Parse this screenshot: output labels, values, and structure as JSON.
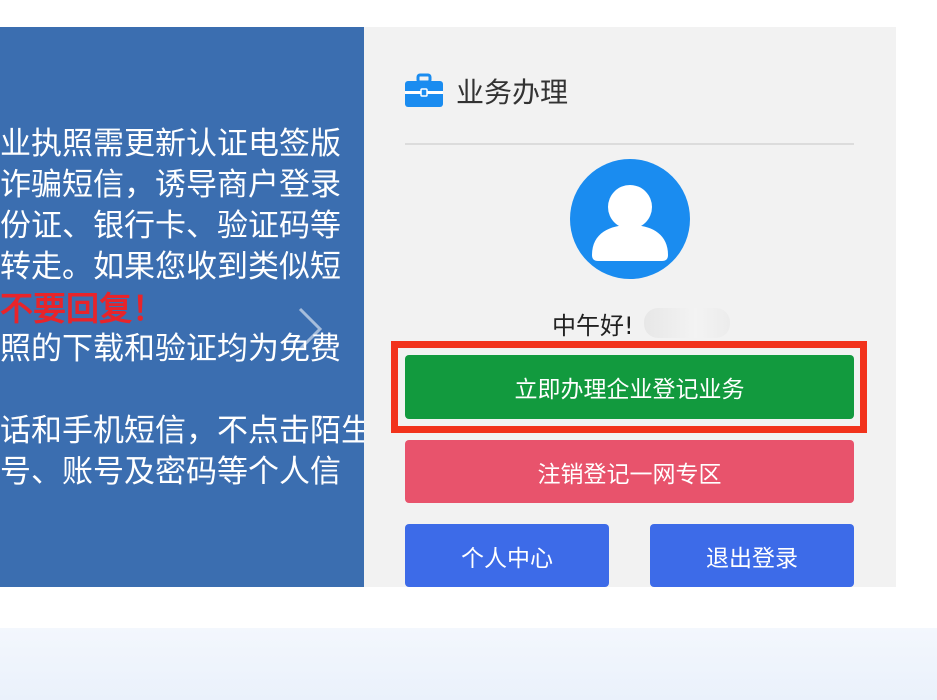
{
  "banner": {
    "lines": [
      "业执照需更新认证电签版",
      "诈骗短信，诱导商户登录",
      "份证、银行卡、验证码等",
      "转走。如果您收到类似短",
      "不要回复！",
      "照的下载和验证均为免费",
      "",
      "话和手机短信，不点击陌生",
      "号、账号及密码等个人信"
    ]
  },
  "panel": {
    "title": "业务办理",
    "icon": "briefcase-icon",
    "greeting": "中午好!",
    "buttons": {
      "register": "立即办理企业登记业务",
      "deregister": "注销登记一网专区",
      "personal_center": "个人中心",
      "logout": "退出登录"
    }
  },
  "colors": {
    "banner_bg": "#3b6eb0",
    "panel_bg": "#f2f2f2",
    "accent_blue": "#1a8cf0",
    "green_button": "#129a3e",
    "red_button": "#e8536c",
    "blue_button": "#3d6be8",
    "highlight_border": "#f2331c",
    "warning_text": "#e8242a"
  }
}
